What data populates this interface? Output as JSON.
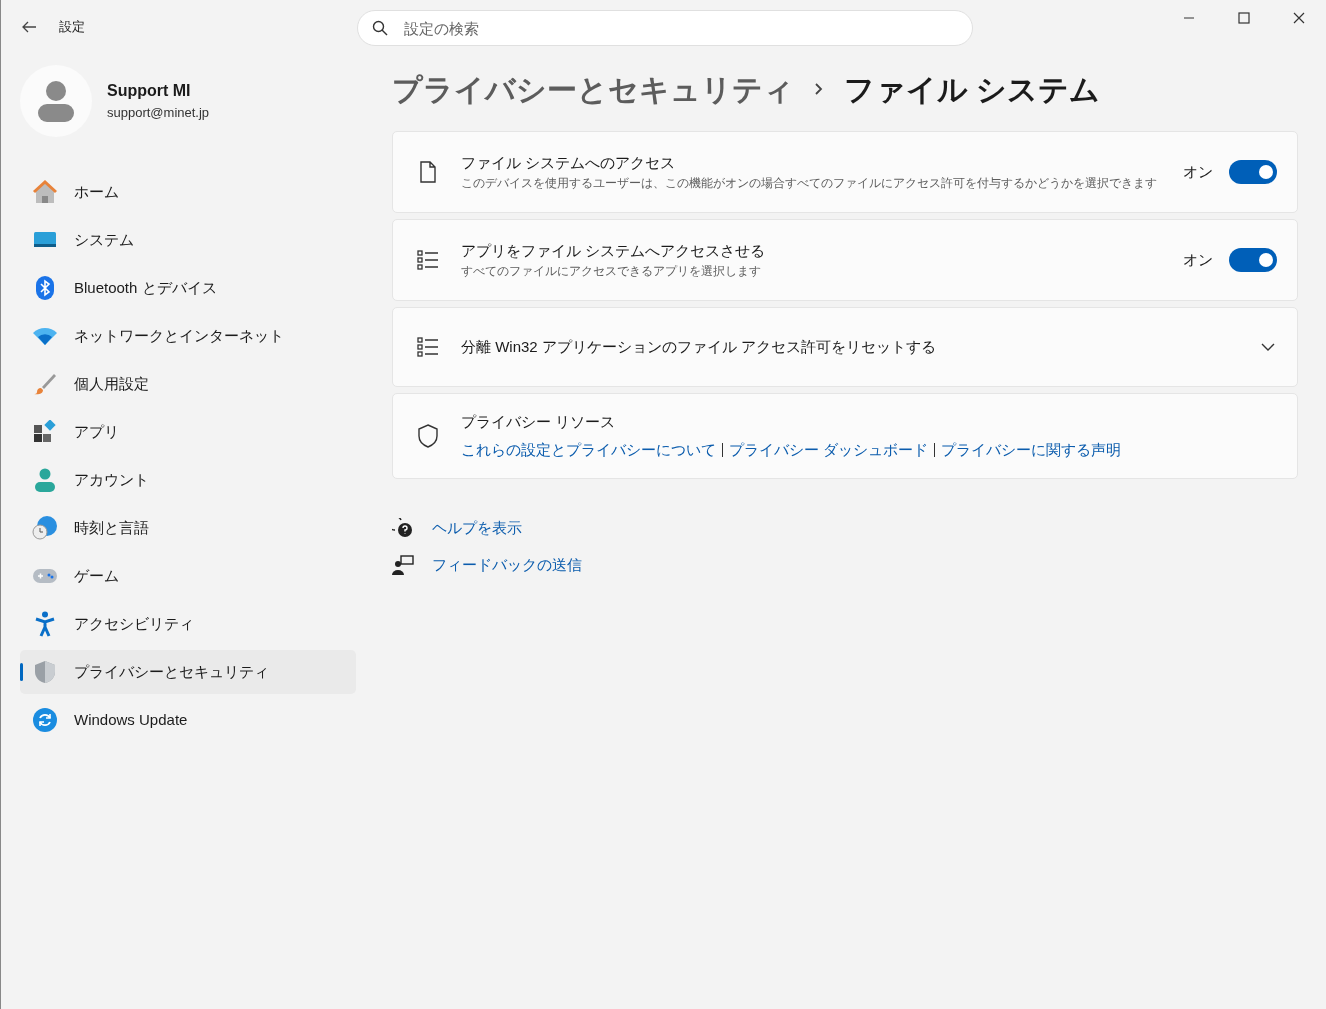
{
  "window": {
    "title": "設定"
  },
  "search": {
    "placeholder": "設定の検索"
  },
  "account": {
    "name": "Support MI",
    "email": "support@minet.jp"
  },
  "sidebar": {
    "items": [
      {
        "label": "ホーム",
        "selected": false
      },
      {
        "label": "システム",
        "selected": false
      },
      {
        "label": "Bluetooth とデバイス",
        "selected": false
      },
      {
        "label": "ネットワークとインターネット",
        "selected": false
      },
      {
        "label": "個人用設定",
        "selected": false
      },
      {
        "label": "アプリ",
        "selected": false
      },
      {
        "label": "アカウント",
        "selected": false
      },
      {
        "label": "時刻と言語",
        "selected": false
      },
      {
        "label": "ゲーム",
        "selected": false
      },
      {
        "label": "アクセシビリティ",
        "selected": false
      },
      {
        "label": "プライバシーとセキュリティ",
        "selected": true
      },
      {
        "label": "Windows Update",
        "selected": false
      }
    ]
  },
  "breadcrumb": [
    {
      "label": "プライバシーとセキュリティ"
    },
    {
      "label": "ファイル システム"
    }
  ],
  "settings": [
    {
      "kind": "toggle",
      "title": "ファイル システムへのアクセス",
      "description": "このデバイスを使用するユーザーは、この機能がオンの場合すべてのファイルにアクセス許可を付与するかどうかを選択できます",
      "state_label": "オン",
      "on": true
    },
    {
      "kind": "toggle",
      "title": "アプリをファイル システムへアクセスさせる",
      "description": "すべてのファイルにアクセスできるアプリを選択します",
      "state_label": "オン",
      "on": true
    },
    {
      "kind": "expander",
      "title": "分離 Win32 アプリケーションのファイル アクセス許可をリセットする",
      "expanded": false
    },
    {
      "kind": "links",
      "title": "プライバシー リソース",
      "links": [
        "これらの設定とプライバシーについて",
        "プライバシー ダッシュボード",
        "プライバシーに関する声明"
      ]
    }
  ],
  "help_links": [
    {
      "label": "ヘルプを表示"
    },
    {
      "label": "フィードバックの送信"
    }
  ]
}
